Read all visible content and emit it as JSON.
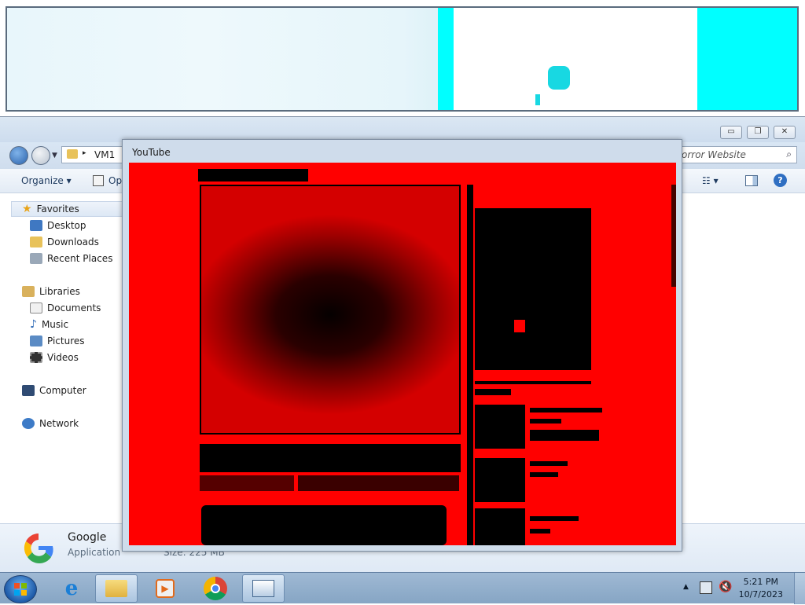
{
  "explorer": {
    "breadcrumb": "VM1",
    "search_placeholder": "orror Website",
    "toolbar": {
      "organize": "Organize",
      "open": "Ope"
    },
    "nav": {
      "favorites": "Favorites",
      "desktop": "Desktop",
      "downloads": "Downloads",
      "recent": "Recent Places",
      "libraries": "Libraries",
      "documents": "Documents",
      "music": "Music",
      "pictures": "Pictures",
      "videos": "Videos",
      "computer": "Computer",
      "network": "Network"
    },
    "details": {
      "name": "Google",
      "type": "Application",
      "size": "Size: 225 MB"
    }
  },
  "popup": {
    "title": "YouTube"
  },
  "taskbar": {
    "time": "5:21 PM",
    "date": "10/7/2023",
    "apps": [
      "ie-icon",
      "explorer-icon",
      "media-player-icon",
      "chrome-icon",
      "app-window-icon"
    ]
  },
  "colors": {
    "glitch": "#ff0000",
    "cyan": "#00ffff",
    "taskbar": "#9fb9d4"
  }
}
